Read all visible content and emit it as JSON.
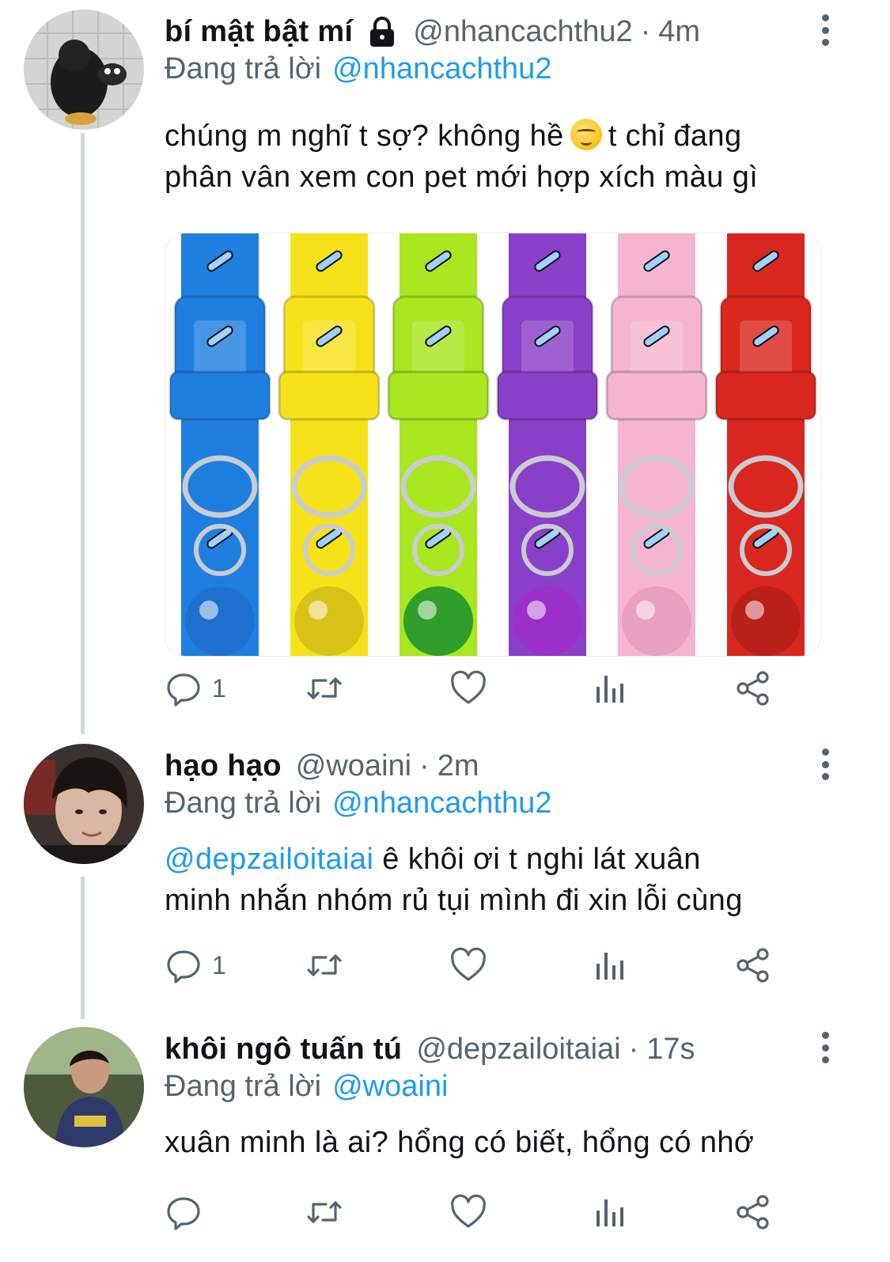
{
  "colors": {
    "accent": "#1d9bf0",
    "muted": "#536471",
    "text": "#0f1419",
    "thread_line": "#cfd9de"
  },
  "tweets": [
    {
      "name": "bí mật bật mí",
      "locked": true,
      "handle": "@nhancachthu2",
      "separator": "·",
      "time": "4m",
      "reply_prefix": "Đang trả lời",
      "reply_to": "@nhancachthu2",
      "text_line1_a": "chúng m nghĩ t sợ? không hề",
      "emoji": "smirk-emoji",
      "text_line1_b": "t chỉ đang",
      "text_line2": "phân vân xem con pet mới hợp xích màu gì",
      "media": {
        "description_icon": "pet-collars-image",
        "collar_colors": [
          "#1f7fe0",
          "#f7e21a",
          "#a8e61f",
          "#8a3fc9",
          "#f6b5cf",
          "#d9261f"
        ]
      },
      "reply_count": "1"
    },
    {
      "name": "hạo hạo",
      "handle": "@woaini",
      "separator": "·",
      "time": "2m",
      "reply_prefix": "Đang trả lời",
      "reply_to": "@nhancachthu2",
      "mention": "@depzailoitaiai",
      "text_line1": "ê khôi ơi t nghi lát xuân",
      "text_line2": "minh nhắn nhóm rủ tụi mình đi xin lỗi cùng",
      "reply_count": "1"
    },
    {
      "name": "khôi ngô tuấn tú",
      "handle": "@depzailoitaiai",
      "separator": "·",
      "time": "17s",
      "reply_prefix": "Đang trả lời",
      "reply_to": "@woaini",
      "text_line1": "xuân minh là ai? hổng có biết, hổng có nhớ",
      "reply_count": ""
    }
  ],
  "icons": {
    "reply": "reply-icon",
    "retweet": "retweet-icon",
    "like": "heart-icon",
    "analytics": "analytics-icon",
    "share": "share-icon",
    "more": "more-options-icon",
    "lock": "lock-icon"
  }
}
